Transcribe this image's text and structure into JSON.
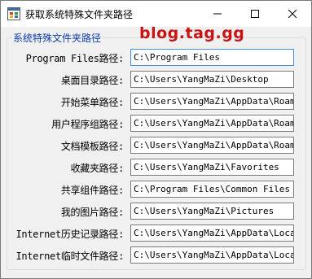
{
  "window": {
    "title": "获取系统特殊文件夹路径"
  },
  "group": {
    "title": "系统特殊文件夹路径"
  },
  "watermark": {
    "text": "blog.tag.gg"
  },
  "rows": [
    {
      "label": "Program Files路径:",
      "value": "C:\\Program Files"
    },
    {
      "label": "桌面目录路径:",
      "value": "C:\\Users\\YangMaZi\\Desktop"
    },
    {
      "label": "开始菜单路径:",
      "value": "C:\\Users\\YangMaZi\\AppData\\Roaming"
    },
    {
      "label": "用户程序组路径:",
      "value": "C:\\Users\\YangMaZi\\AppData\\Roaming"
    },
    {
      "label": "文档模板路径:",
      "value": "C:\\Users\\YangMaZi\\AppData\\Roaming"
    },
    {
      "label": "收藏夹路径:",
      "value": "C:\\Users\\YangMaZi\\Favorites"
    },
    {
      "label": "共享组件路径:",
      "value": "C:\\Program Files\\Common Files"
    },
    {
      "label": "我的图片路径:",
      "value": "C:\\Users\\YangMaZi\\Pictures"
    },
    {
      "label": "Internet历史记录路径:",
      "value": "C:\\Users\\YangMaZi\\AppData\\Local\\M"
    },
    {
      "label": "Internet临时文件路径:",
      "value": "C:\\Users\\YangMaZi\\AppData\\Local\\M"
    }
  ]
}
